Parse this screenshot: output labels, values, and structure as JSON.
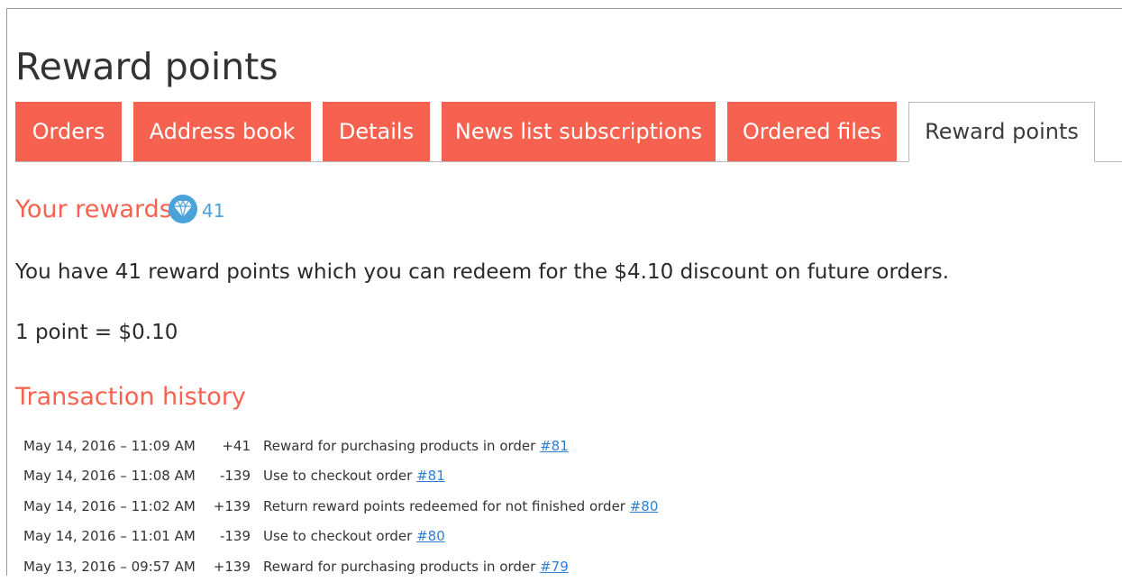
{
  "page": {
    "title": "Reward points"
  },
  "tabs": [
    {
      "label": "Orders",
      "active": false
    },
    {
      "label": "Address book",
      "active": false
    },
    {
      "label": "Details",
      "active": false
    },
    {
      "label": "News list subscriptions",
      "active": false
    },
    {
      "label": "Ordered files",
      "active": false
    },
    {
      "label": "Reward points",
      "active": true
    }
  ],
  "rewards": {
    "heading": "Your rewards",
    "icon": "diamond-icon",
    "points": "41",
    "message": "You have 41 reward points which you can redeem for the $4.10 discount on future orders.",
    "rate": "1 point = $0.10"
  },
  "history": {
    "heading": "Transaction history",
    "rows": [
      {
        "date": "May 14, 2016 – 11:09 AM",
        "amount": "+41",
        "text": "Reward for purchasing products in order ",
        "link": "#81"
      },
      {
        "date": "May 14, 2016 – 11:08 AM",
        "amount": "-139",
        "text": "Use to checkout order ",
        "link": "#81"
      },
      {
        "date": "May 14, 2016 – 11:02 AM",
        "amount": "+139",
        "text": "Return reward points redeemed for not finished order ",
        "link": "#80"
      },
      {
        "date": "May 14, 2016 – 11:01 AM",
        "amount": "-139",
        "text": "Use to checkout order ",
        "link": "#80"
      },
      {
        "date": "May 13, 2016 – 09:57 AM",
        "amount": "+139",
        "text": "Reward for purchasing products in order ",
        "link": "#79"
      }
    ]
  },
  "colors": {
    "accent": "#f6624f",
    "badge": "#4aa3d8",
    "link": "#2e7fd1"
  }
}
